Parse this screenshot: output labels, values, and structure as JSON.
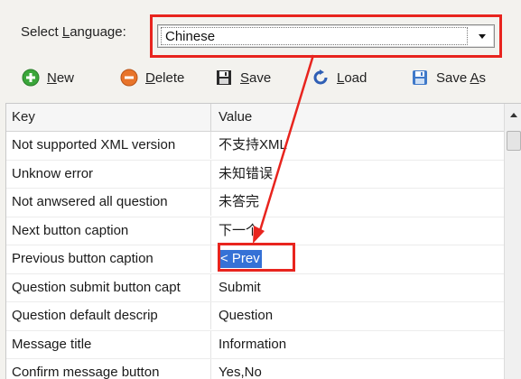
{
  "language": {
    "label": "Select Language:",
    "label_underline_char": "L",
    "selected": "Chinese"
  },
  "toolbar": {
    "new_label": "New",
    "delete_label": "Delete",
    "save_label": "Save",
    "load_label": "Load",
    "save_as_label": "Save As"
  },
  "grid": {
    "columns": [
      "Key",
      "Value"
    ],
    "rows": [
      {
        "key": "Not supported XML version",
        "value": "不支持XML"
      },
      {
        "key": "Unknow error",
        "value": "未知错误"
      },
      {
        "key": "Not anwsered all question",
        "value": "未答完"
      },
      {
        "key": "Next button caption",
        "value": "下一个"
      },
      {
        "key": "Previous button caption",
        "value": "< Prev"
      },
      {
        "key": "Question submit button capt",
        "value": "Submit"
      },
      {
        "key": "Question default descrip",
        "value": "Question"
      },
      {
        "key": "Message title",
        "value": "Information"
      },
      {
        "key": "Confirm message button",
        "value": "Yes,No"
      }
    ]
  },
  "colors": {
    "annotation_red": "#e8241e",
    "selection_blue": "#3571d6",
    "new_icon_green": "#3aa63a",
    "delete_icon_orange": "#e8742a"
  },
  "icons": {
    "new": "plus-circle-icon",
    "delete": "minus-circle-icon",
    "save": "floppy-disk-icon",
    "load": "reload-icon",
    "save_as": "floppy-disk-blue-icon"
  }
}
